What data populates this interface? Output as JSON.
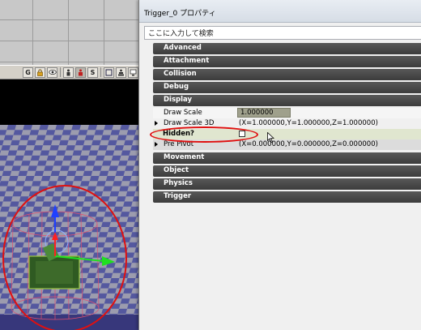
{
  "window": {
    "title": "Trigger_0 プロパティ"
  },
  "search": {
    "value": "ここに入力して検索"
  },
  "toolbar": {
    "buttons": [
      "G",
      "lock-icon",
      "eye-icon",
      "actor-icon",
      "select-icon",
      "S",
      "box-icon",
      "pawn-icon",
      "monitor-icon"
    ]
  },
  "categories_top": [
    "Advanced",
    "Attachment",
    "Collision",
    "Debug",
    "Display"
  ],
  "display_props": {
    "draw_scale": {
      "name": "Draw Scale",
      "value": "1.000000"
    },
    "draw_scale_3d": {
      "name": "Draw Scale 3D",
      "value": "(X=1.000000,Y=1.000000,Z=1.000000)"
    },
    "hidden": {
      "name": "Hidden?",
      "checked": false
    },
    "pre_pivot": {
      "name": "Pre Pivot",
      "value": "(X=0.000000,Y=0.000000,Z=0.000000)"
    }
  },
  "categories_bottom": [
    "Movement",
    "Object",
    "Physics",
    "Trigger"
  ],
  "colors": {
    "highlight_oval": "#e01010",
    "category_bar": "#4a4a4a",
    "draw_scale_field": "#9fa08c"
  }
}
